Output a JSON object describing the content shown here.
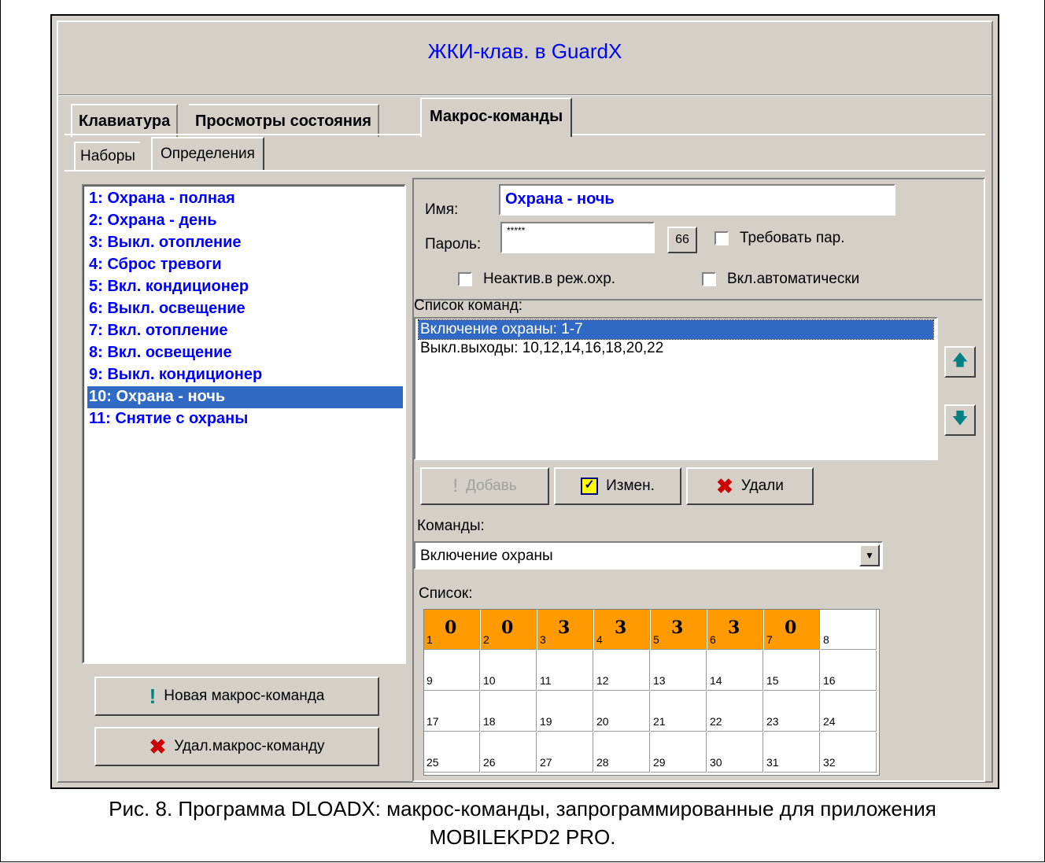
{
  "window": {
    "title": "ЖКИ-клав. в GuardX"
  },
  "tabs": [
    "Клавиатура",
    "Просмотры состояния",
    "Макрос-команды"
  ],
  "subtabs": [
    "Наборы",
    "Определения"
  ],
  "macros": [
    "1: Охрана - полная",
    "2: Охрана - день",
    "3: Выкл. отопление",
    "4: Сброс тревоги",
    "5: Вкл. кондиционер",
    "6: Выкл. освещение",
    "7: Вкл. отопление",
    "8: Вкл. освещение",
    "9: Выкл. кондиционер",
    "10: Охрана - ночь",
    "11: Снятие с охраны"
  ],
  "selected_macro": "10: Охрана - ночь",
  "left_buttons": {
    "new": "Новая макрос-команда",
    "delete": "Удал.макрос-команду"
  },
  "form": {
    "name_label": "Имя:",
    "name_value": "Охрана - ночь",
    "password_label": "Пароль:",
    "password_value": "*****",
    "show_password_glyph": "66",
    "require_password": "Требовать пар.",
    "inactive_armed": "Неактив.в реж.охр.",
    "auto_enable": "Вкл.автоматически"
  },
  "command_list": {
    "label": "Список команд:",
    "items": [
      "Включение охраны: 1-7",
      "Выкл.выходы: 10,12,14,16,18,20,22"
    ]
  },
  "action_buttons": {
    "add": "Добавь",
    "edit": "Измен.",
    "delete": "Удали"
  },
  "commands": {
    "label": "Команды:",
    "selected": "Включение охраны"
  },
  "list": {
    "label": "Список:",
    "cells": [
      {
        "n": "1",
        "v": "0"
      },
      {
        "n": "2",
        "v": "0"
      },
      {
        "n": "3",
        "v": "3"
      },
      {
        "n": "4",
        "v": "3"
      },
      {
        "n": "5",
        "v": "3"
      },
      {
        "n": "6",
        "v": "3"
      },
      {
        "n": "7",
        "v": "0"
      },
      {
        "n": "8",
        "v": ""
      },
      {
        "n": "9",
        "v": ""
      },
      {
        "n": "10",
        "v": ""
      },
      {
        "n": "11",
        "v": ""
      },
      {
        "n": "12",
        "v": ""
      },
      {
        "n": "13",
        "v": ""
      },
      {
        "n": "14",
        "v": ""
      },
      {
        "n": "15",
        "v": ""
      },
      {
        "n": "16",
        "v": ""
      },
      {
        "n": "17",
        "v": ""
      },
      {
        "n": "18",
        "v": ""
      },
      {
        "n": "19",
        "v": ""
      },
      {
        "n": "20",
        "v": ""
      },
      {
        "n": "21",
        "v": ""
      },
      {
        "n": "22",
        "v": ""
      },
      {
        "n": "23",
        "v": ""
      },
      {
        "n": "24",
        "v": ""
      },
      {
        "n": "25",
        "v": ""
      },
      {
        "n": "26",
        "v": ""
      },
      {
        "n": "27",
        "v": ""
      },
      {
        "n": "28",
        "v": ""
      },
      {
        "n": "29",
        "v": ""
      },
      {
        "n": "30",
        "v": ""
      },
      {
        "n": "31",
        "v": ""
      },
      {
        "n": "32",
        "v": ""
      }
    ]
  },
  "caption": {
    "line1": "Рис. 8. Программа DLOADX: макрос-команды, запрограммированные для приложения",
    "line2": "MOBILEKPD2 PRO."
  },
  "colors": {
    "selection": "#316ac5",
    "active_cell": "#ff9a00",
    "macro_text": "#0000ff"
  }
}
